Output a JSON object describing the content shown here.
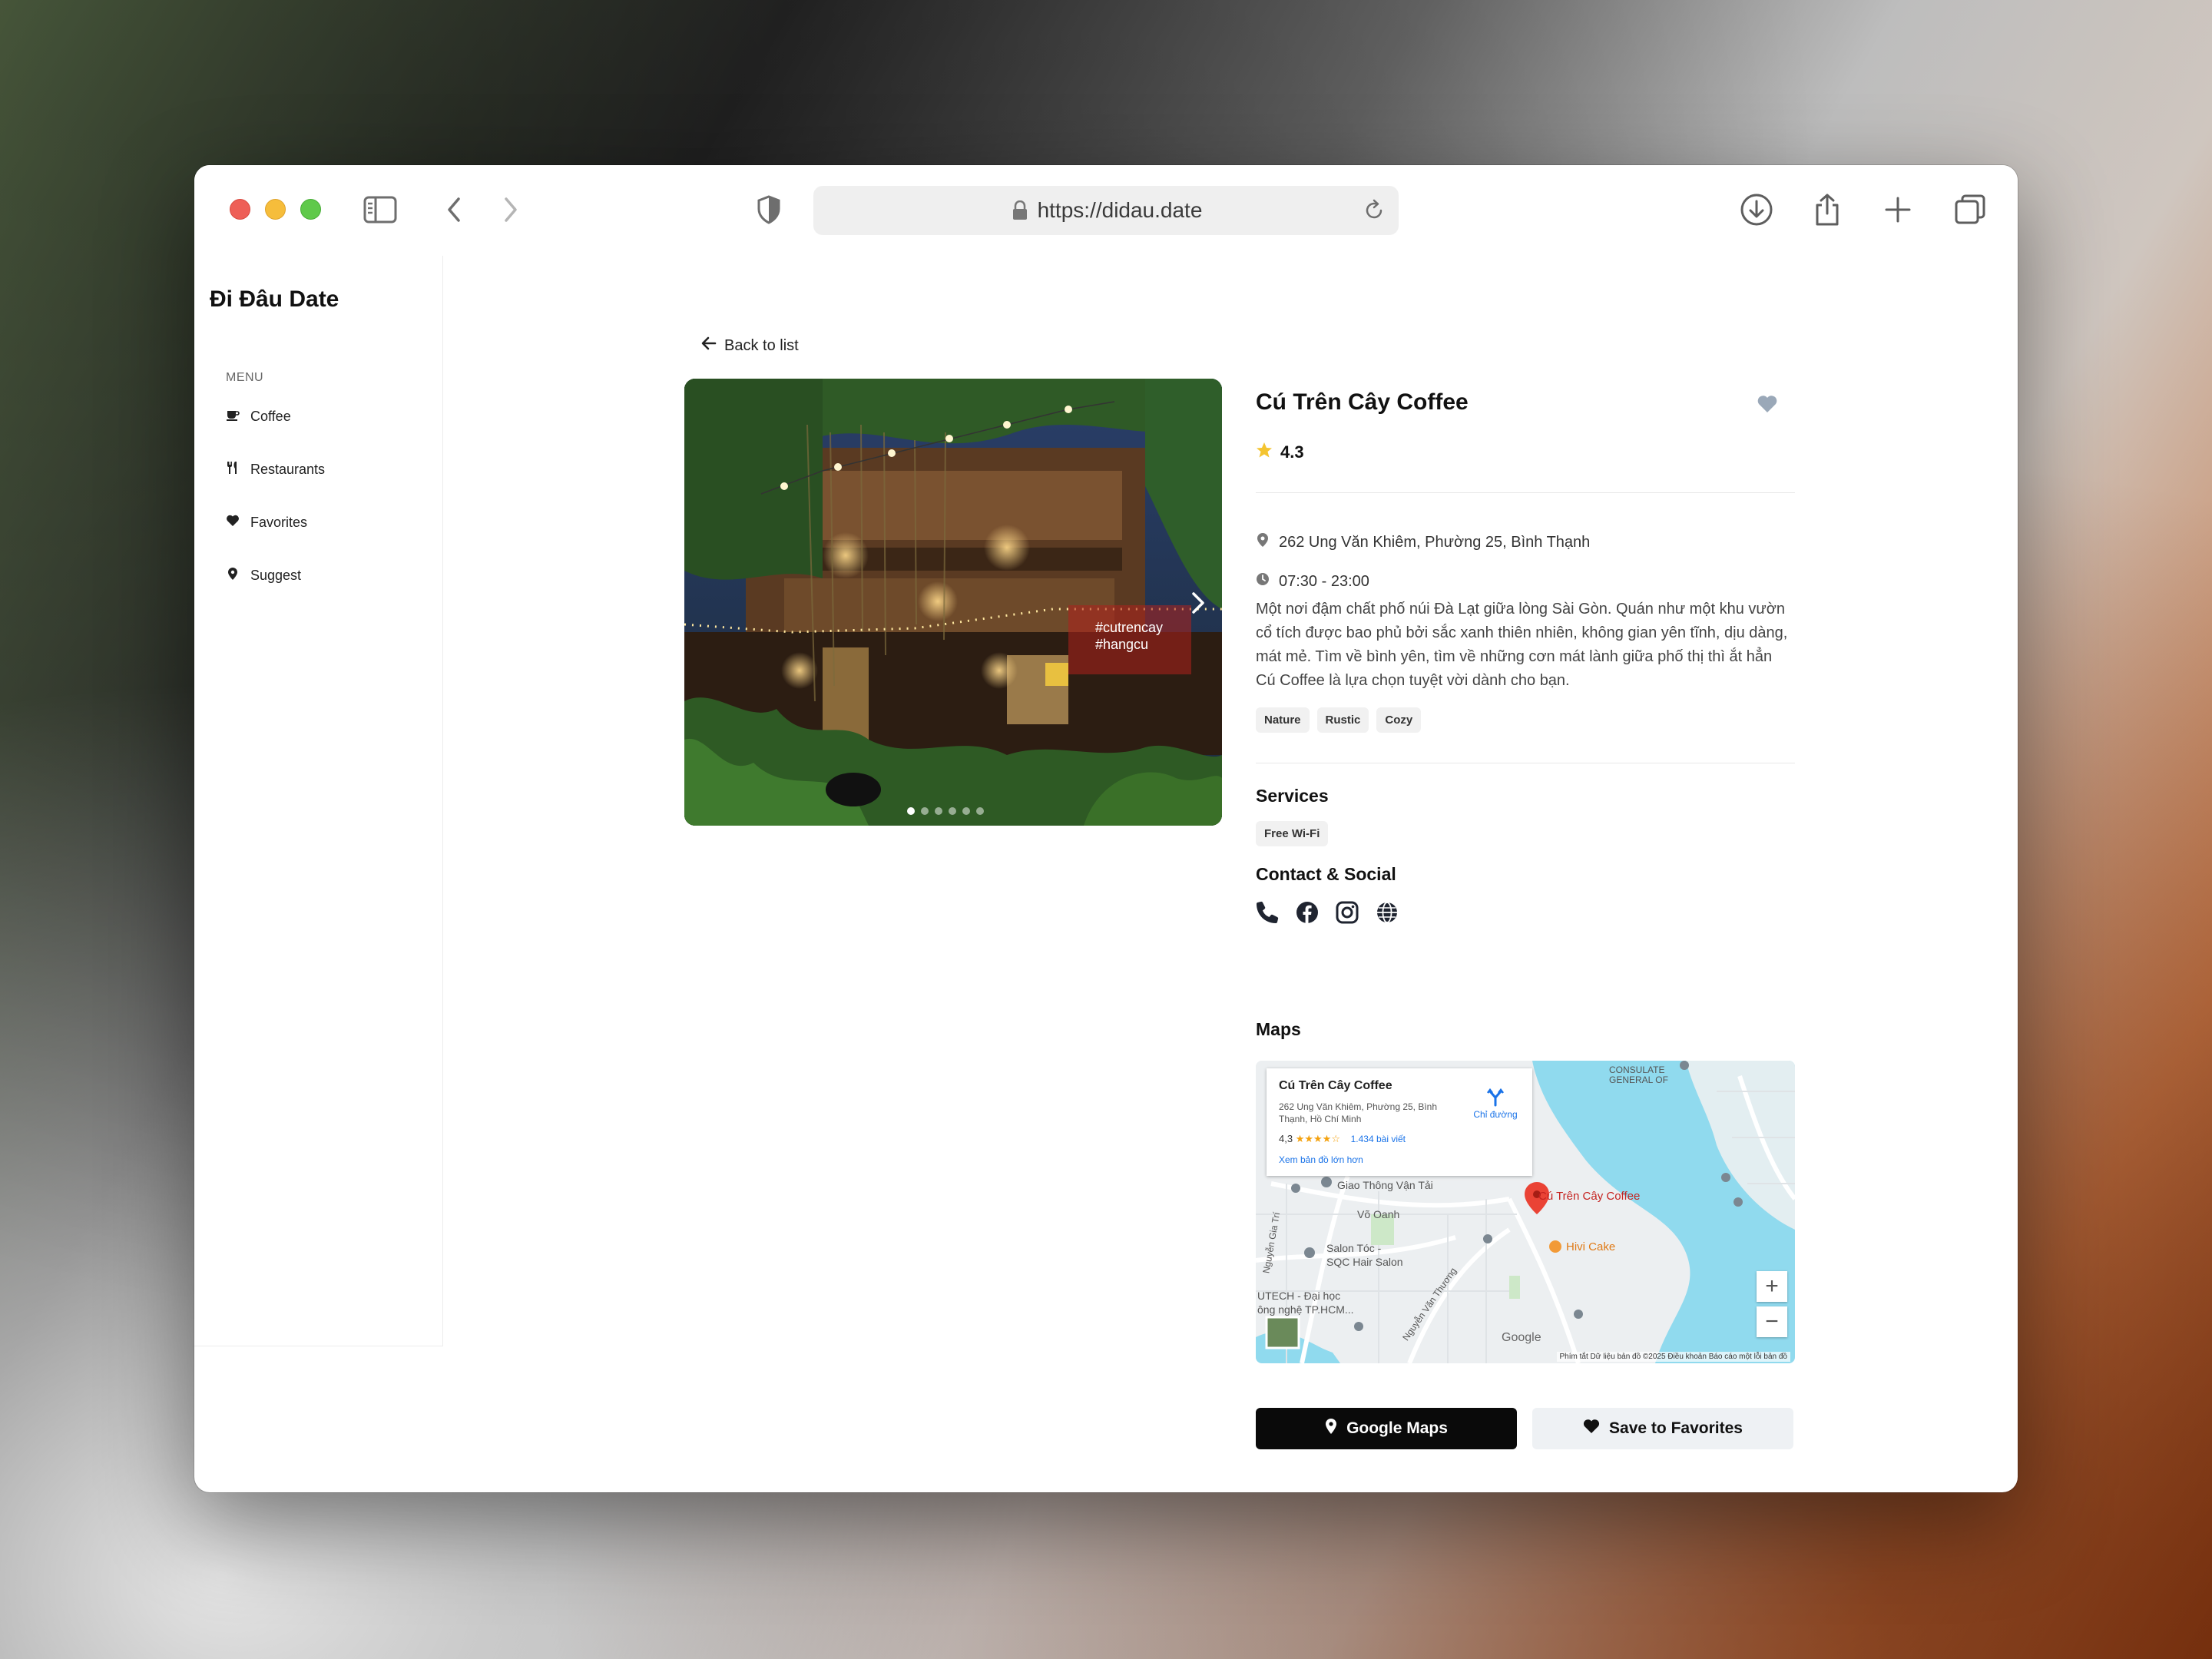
{
  "browser": {
    "url": "https://didau.date"
  },
  "sidebar": {
    "brand": "Đi Đâu Date",
    "menu_label": "MENU",
    "items": [
      {
        "label": "Coffee",
        "icon": "coffee-icon"
      },
      {
        "label": "Restaurants",
        "icon": "utensils-icon"
      },
      {
        "label": "Favorites",
        "icon": "heart-icon"
      },
      {
        "label": "Suggest",
        "icon": "map-pin-icon"
      }
    ]
  },
  "main": {
    "back_label": "Back to list",
    "hero": {
      "neon_line1": "#cutrencay",
      "neon_line2": "#hangcu",
      "slides": 6,
      "active_slide": 1
    },
    "place": {
      "title": "Cú Trên Cây Coffee",
      "rating": "4.3",
      "address": "262 Ung Văn Khiêm, Phường 25, Bình Thạnh",
      "hours": "07:30 - 23:00",
      "description": "Một nơi đậm chất phố núi Đà Lạt giữa lòng Sài Gòn. Quán như một khu vườn cổ tích được bao phủ bởi sắc xanh thiên nhiên, không gian yên tĩnh, dịu dàng, mát mẻ. Tìm về bình yên, tìm về những cơn mát lành giữa phố thị thì ắt hẳn Cú Coffee là lựa chọn tuyệt vời dành cho bạn.",
      "tags": [
        "Nature",
        "Rustic",
        "Cozy"
      ]
    },
    "services": {
      "title": "Services",
      "items": [
        "Free Wi-Fi"
      ]
    },
    "contact": {
      "title": "Contact & Social",
      "icons": [
        "phone-icon",
        "facebook-icon",
        "instagram-icon",
        "globe-icon"
      ]
    },
    "maps": {
      "title": "Maps",
      "card_title": "Cú Trên Cây Coffee",
      "card_address": "262 Ung Văn Khiêm, Phường 25, Bình Thạnh, Hồ Chí Minh",
      "card_rating": "4,3",
      "card_stars": "★★★★☆",
      "card_reviews": "1.434 bài viết",
      "card_link": "Xem bản đồ lớn hơn",
      "directions": "Chỉ đường",
      "pin_label": "Cú Trên Cây Coffee",
      "labels": {
        "hivi": "Hivi Cake",
        "transport": "Giao Thông Vận Tải",
        "vo_oanh": "Võ Oanh",
        "salon1": "Salon Tóc -",
        "salon2": "SQC Hair Salon",
        "uni1": "UTECH - Đại học",
        "uni2": "ông nghệ TP.HCM...",
        "nguyen_gia_tri": "Nguyễn Gia Trí",
        "nguyen_van_thuong": "Nguyễn Văn Thương",
        "consulate": "CONSULATE GENERAL OF",
        "google": "Google"
      },
      "footer": "Phím tắt   Dữ liệu bản đồ ©2025   Điều khoản   Báo cáo một lỗi bản đồ",
      "zoom_in": "+",
      "zoom_out": "−"
    },
    "buttons": {
      "google_maps": "Google Maps",
      "save_favorites": "Save to Favorites"
    }
  },
  "colors": {
    "accent": "#0a0a0a",
    "star": "#f4c430",
    "map_pin": "#ea4335",
    "water": "#90daee"
  }
}
